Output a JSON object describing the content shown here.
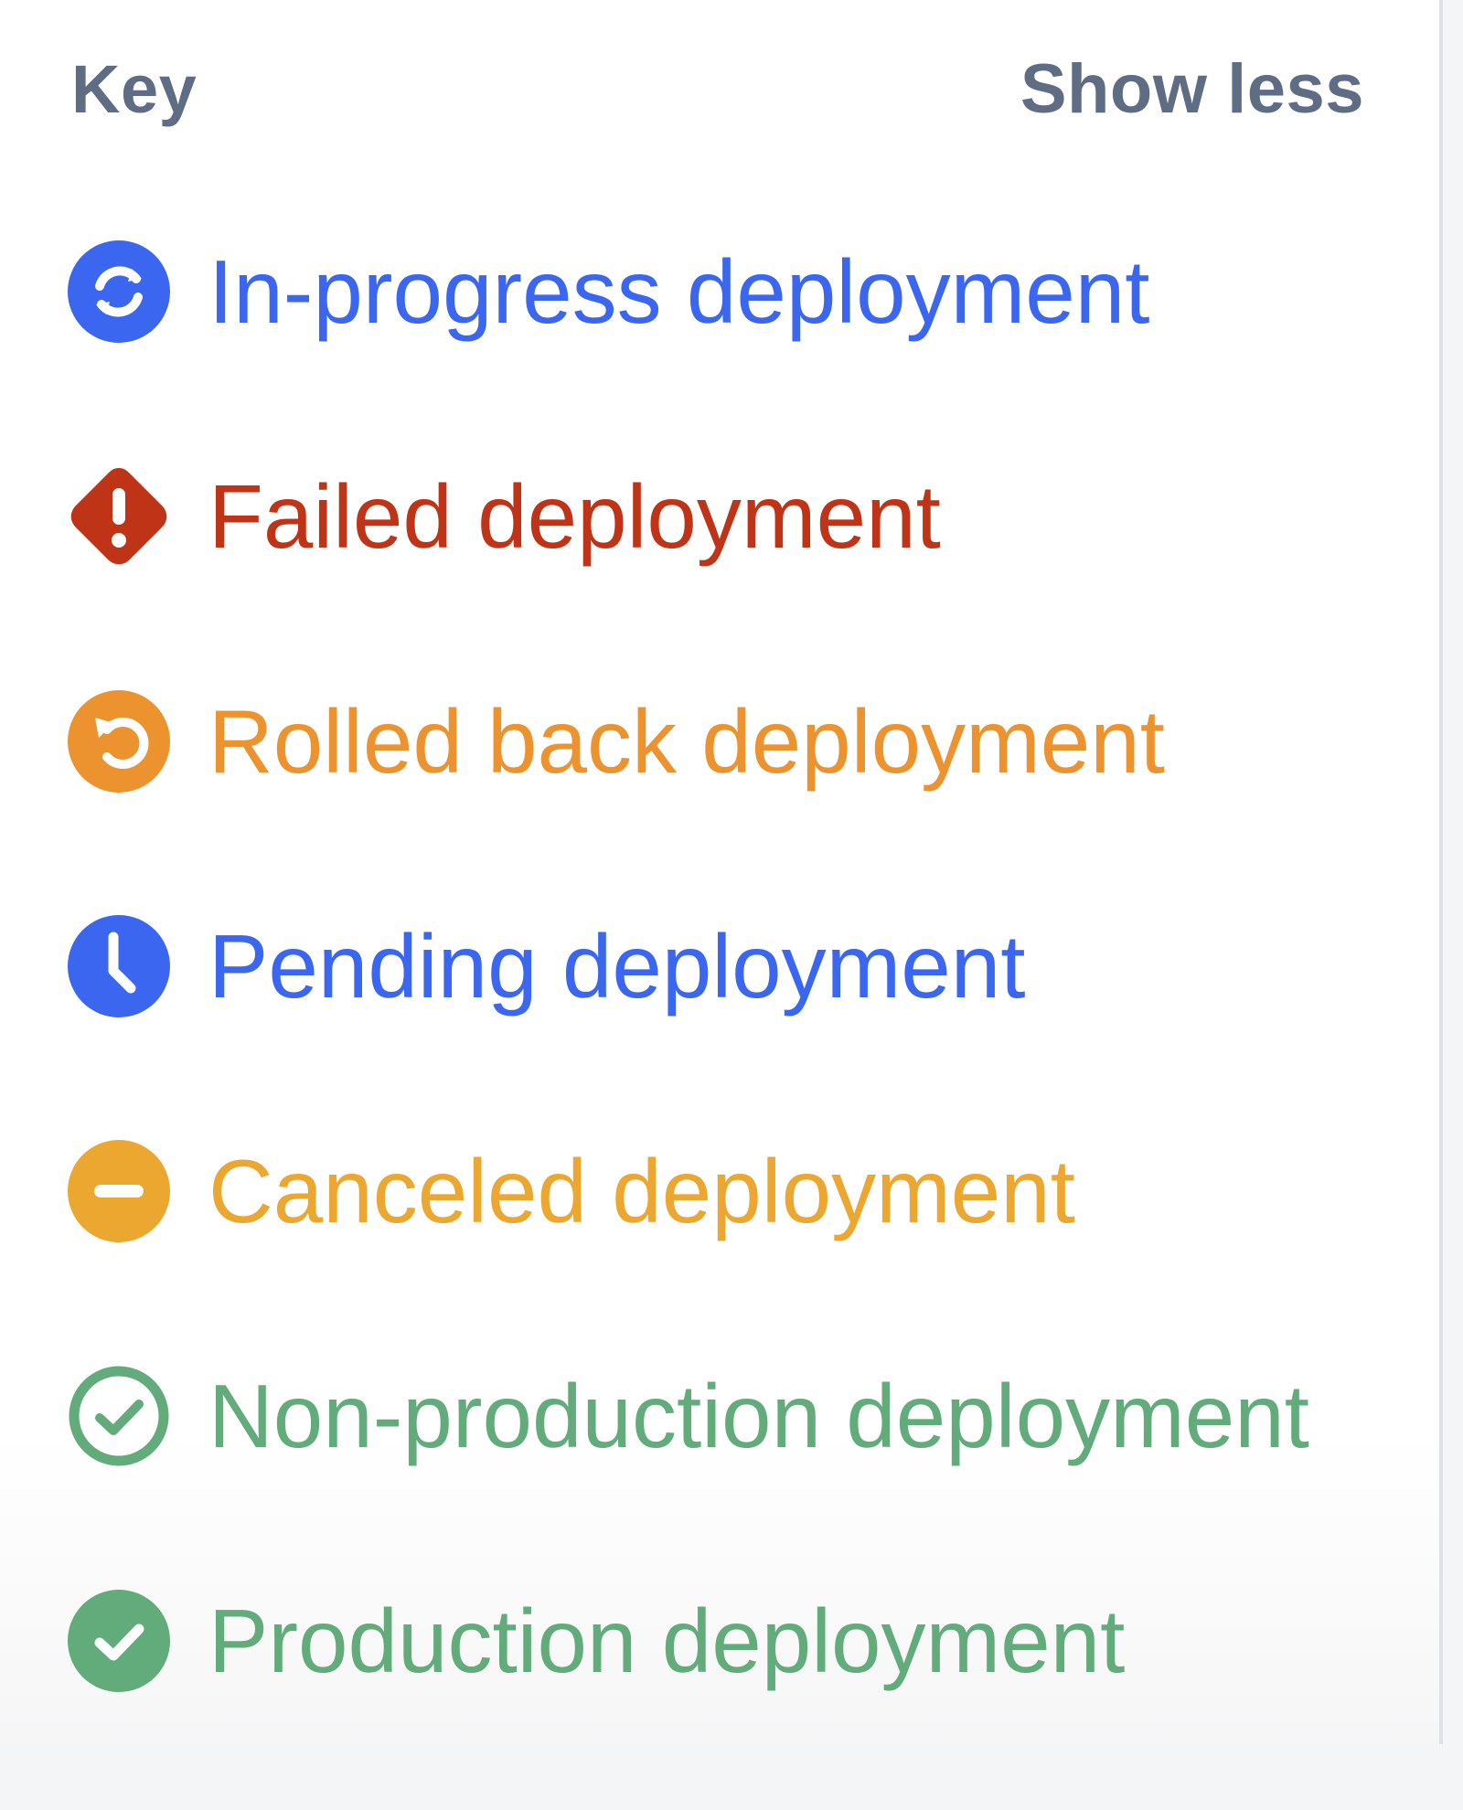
{
  "panel": {
    "title": "Key",
    "toggle_label": "Show less"
  },
  "legend": {
    "items": [
      {
        "label": "In-progress deployment",
        "icon": "in-progress-icon",
        "color": "#3a66f0"
      },
      {
        "label": "Failed deployment",
        "icon": "failed-icon",
        "color": "#bf3317"
      },
      {
        "label": "Rolled back deployment",
        "icon": "rolled-back-icon",
        "color": "#ec9330"
      },
      {
        "label": "Pending deployment",
        "icon": "pending-icon",
        "color": "#3a66f0"
      },
      {
        "label": "Canceled deployment",
        "icon": "canceled-icon",
        "color": "#eba72f"
      },
      {
        "label": "Non-production deployment",
        "icon": "non-production-icon",
        "color": "#62ab7a"
      },
      {
        "label": "Production deployment",
        "icon": "production-icon",
        "color": "#62ab7a"
      }
    ]
  }
}
